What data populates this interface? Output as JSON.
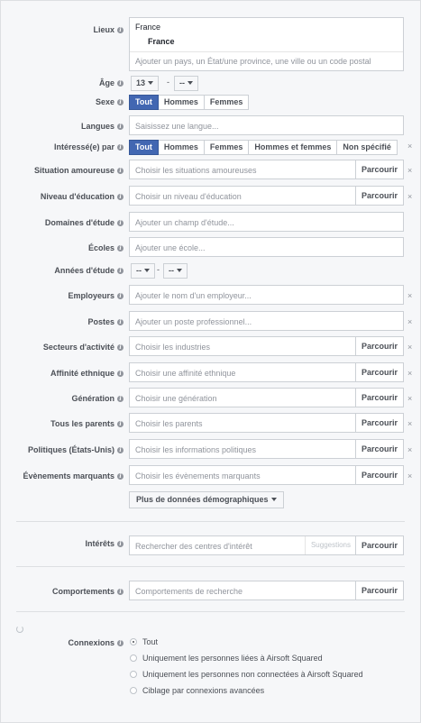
{
  "lieux": {
    "label": "Lieux",
    "country_header": "France",
    "selected": "France",
    "placeholder": "Ajouter un pays, un État/une province, une ville ou un code postal"
  },
  "age": {
    "label": "Âge",
    "min": "13",
    "max": "--",
    "dash": "-"
  },
  "sexe": {
    "label": "Sexe",
    "options": [
      "Tout",
      "Hommes",
      "Femmes"
    ]
  },
  "langues": {
    "label": "Langues",
    "placeholder": "Saisissez une langue..."
  },
  "interesse": {
    "label": "Intéressé(e) par",
    "options": [
      "Tout",
      "Hommes",
      "Femmes",
      "Hommes et femmes",
      "Non spécifié"
    ]
  },
  "browse_label": "Parcourir",
  "remove_glyph": "×",
  "situation": {
    "label": "Situation amoureuse",
    "placeholder": "Choisir les situations amoureuses"
  },
  "education": {
    "label": "Niveau d'éducation",
    "placeholder": "Choisir un niveau d'éducation"
  },
  "domaines": {
    "label": "Domaines d'étude",
    "placeholder": "Ajouter un champ d'étude..."
  },
  "ecoles": {
    "label": "Écoles",
    "placeholder": "Ajouter une école..."
  },
  "annees": {
    "label": "Années d'étude",
    "from": "--",
    "to": "--",
    "dash": "-"
  },
  "employeurs": {
    "label": "Employeurs",
    "placeholder": "Ajouter le nom d'un employeur..."
  },
  "postes": {
    "label": "Postes",
    "placeholder": "Ajouter un poste professionnel..."
  },
  "secteurs": {
    "label": "Secteurs d'activité",
    "placeholder": "Choisir les industries"
  },
  "ethnique": {
    "label": "Affinité ethnique",
    "placeholder": "Choisir une affinité ethnique"
  },
  "generation": {
    "label": "Génération",
    "placeholder": "Choisir une génération"
  },
  "parents": {
    "label": "Tous les parents",
    "placeholder": "Choisir les parents"
  },
  "politiques": {
    "label": "Politiques (États-Unis)",
    "placeholder": "Choisir les informations politiques"
  },
  "evenements": {
    "label": "Évènements marquants",
    "placeholder": "Choisir les évènements marquants"
  },
  "plus_button": "Plus de données démographiques",
  "interets": {
    "label": "Intérêts",
    "placeholder": "Rechercher des centres d'intérêt",
    "suggestions": "Suggestions"
  },
  "comportements": {
    "label": "Comportements",
    "placeholder": "Comportements de recherche"
  },
  "connexions": {
    "label": "Connexions",
    "options": [
      "Tout",
      "Uniquement les personnes liées à Airsoft Squared",
      "Uniquement les personnes non connectées à Airsoft Squared",
      "Ciblage par connexions avancées"
    ]
  },
  "colors": {
    "accent": "#4267b2",
    "border": "#ccd0d5",
    "background": "#f6f7f9"
  }
}
